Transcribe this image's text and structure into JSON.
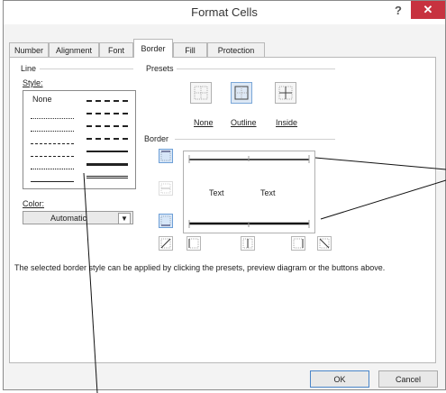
{
  "dialog": {
    "title": "Format Cells",
    "help": "?",
    "close": "✕"
  },
  "tabs": [
    "Number",
    "Alignment",
    "Font",
    "Border",
    "Fill",
    "Protection"
  ],
  "active_tab": "Border",
  "line": {
    "group_label": "Line",
    "style_label": "Style:",
    "none_label": "None",
    "color_label": "Color:",
    "color_value": "Automatic"
  },
  "presets": {
    "group_label": "Presets",
    "items": [
      "None",
      "Outline",
      "Inside"
    ]
  },
  "border": {
    "group_label": "Border",
    "preview_text_left": "Text",
    "preview_text_right": "Text"
  },
  "info_text": "The selected border style can be applied by clicking the presets, preview diagram or the buttons above.",
  "buttons": {
    "ok": "OK",
    "cancel": "Cancel"
  }
}
